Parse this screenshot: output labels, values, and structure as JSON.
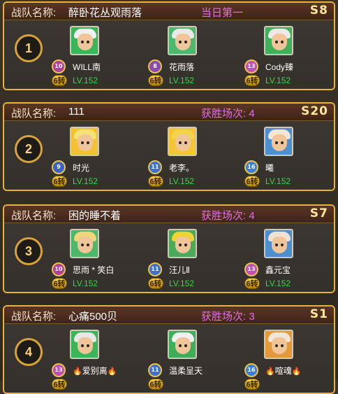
{
  "teams": [
    {
      "label": "战队名称:",
      "name": "醉卧花丛观雨落",
      "status": "当日第一",
      "season": "S8",
      "rank": "1",
      "members": [
        {
          "name": "WILL南",
          "badge_level": "10",
          "badge_color": "#b0409a",
          "zhuan": "6转",
          "level": "LV.152",
          "hair": "#f0f0f0",
          "bg": "#3bb55a"
        },
        {
          "name": "花雨落",
          "badge_level": "8",
          "badge_color": "#8a4bb0",
          "zhuan": "6转",
          "level": "LV.152",
          "hair": "#e9e9e9",
          "bg": "#4cb96f"
        },
        {
          "name": "Cody臻",
          "badge_level": "13",
          "badge_color": "#c04fb8",
          "zhuan": "6转",
          "level": "LV.152",
          "hair": "#eaeaea",
          "bg": "#42b05a"
        }
      ]
    },
    {
      "label": "战队名称:",
      "name": "111",
      "status": "获胜场次: 4",
      "season": "S20",
      "rank": "2",
      "members": [
        {
          "name": "时光",
          "badge_level": "9",
          "badge_color": "#3e62c4",
          "zhuan": "6转",
          "level": "LV.152",
          "hair": "#f3e276",
          "bg": "#f2c232"
        },
        {
          "name": "老李。",
          "badge_level": "11",
          "badge_color": "#3f70d0",
          "zhuan": "6转",
          "level": "LV.152",
          "hair": "#f2d34a",
          "bg": "#f4c534"
        },
        {
          "name": "曦",
          "badge_level": "16",
          "badge_color": "#3c7fd8",
          "zhuan": "6转",
          "level": "LV.152",
          "hair": "#f2e6d6",
          "bg": "#4d8fd2"
        }
      ]
    },
    {
      "label": "战队名称:",
      "name": "困的睡不着",
      "status": "获胜场次: 4",
      "season": "S7",
      "rank": "3",
      "members": [
        {
          "name": "思雨 * 笑白",
          "badge_level": "10",
          "badge_color": "#b0409a",
          "zhuan": "6转",
          "level": "LV.152",
          "hair": "#f2d47a",
          "bg": "#4db86a"
        },
        {
          "name": "汪儿Ⅱ",
          "badge_level": "11",
          "badge_color": "#3f70d0",
          "zhuan": "6转",
          "level": "LV.152",
          "hair": "#f2d234",
          "bg": "#4aaa5a"
        },
        {
          "name": "鑫元宝",
          "badge_level": "13",
          "badge_color": "#c04fb8",
          "zhuan": "6转",
          "level": "LV.152",
          "hair": "#f0e2d2",
          "bg": "#4e8fd4"
        }
      ]
    },
    {
      "label": "战队名称:",
      "name": "心痛500贝",
      "status": "获胜场次: 3",
      "season": "S1",
      "rank": "4",
      "members": [
        {
          "name": "爱别离",
          "badge_level": "13",
          "badge_color": "#c04fb8",
          "zhuan": "6转",
          "level": "",
          "hair": "#e8e8e8",
          "bg": "#3bb55a",
          "flames": true
        },
        {
          "name": "温柔呈天",
          "badge_level": "11",
          "badge_color": "#3f70d0",
          "zhuan": "6转",
          "level": "",
          "hair": "#f0f0f0",
          "bg": "#3fae5a"
        },
        {
          "name": "喧魂",
          "badge_level": "16",
          "badge_color": "#3c7fd8",
          "zhuan": "6转",
          "level": "",
          "hair": "#f2e6d6",
          "bg": "#e59a3a",
          "flames": true
        }
      ]
    }
  ]
}
